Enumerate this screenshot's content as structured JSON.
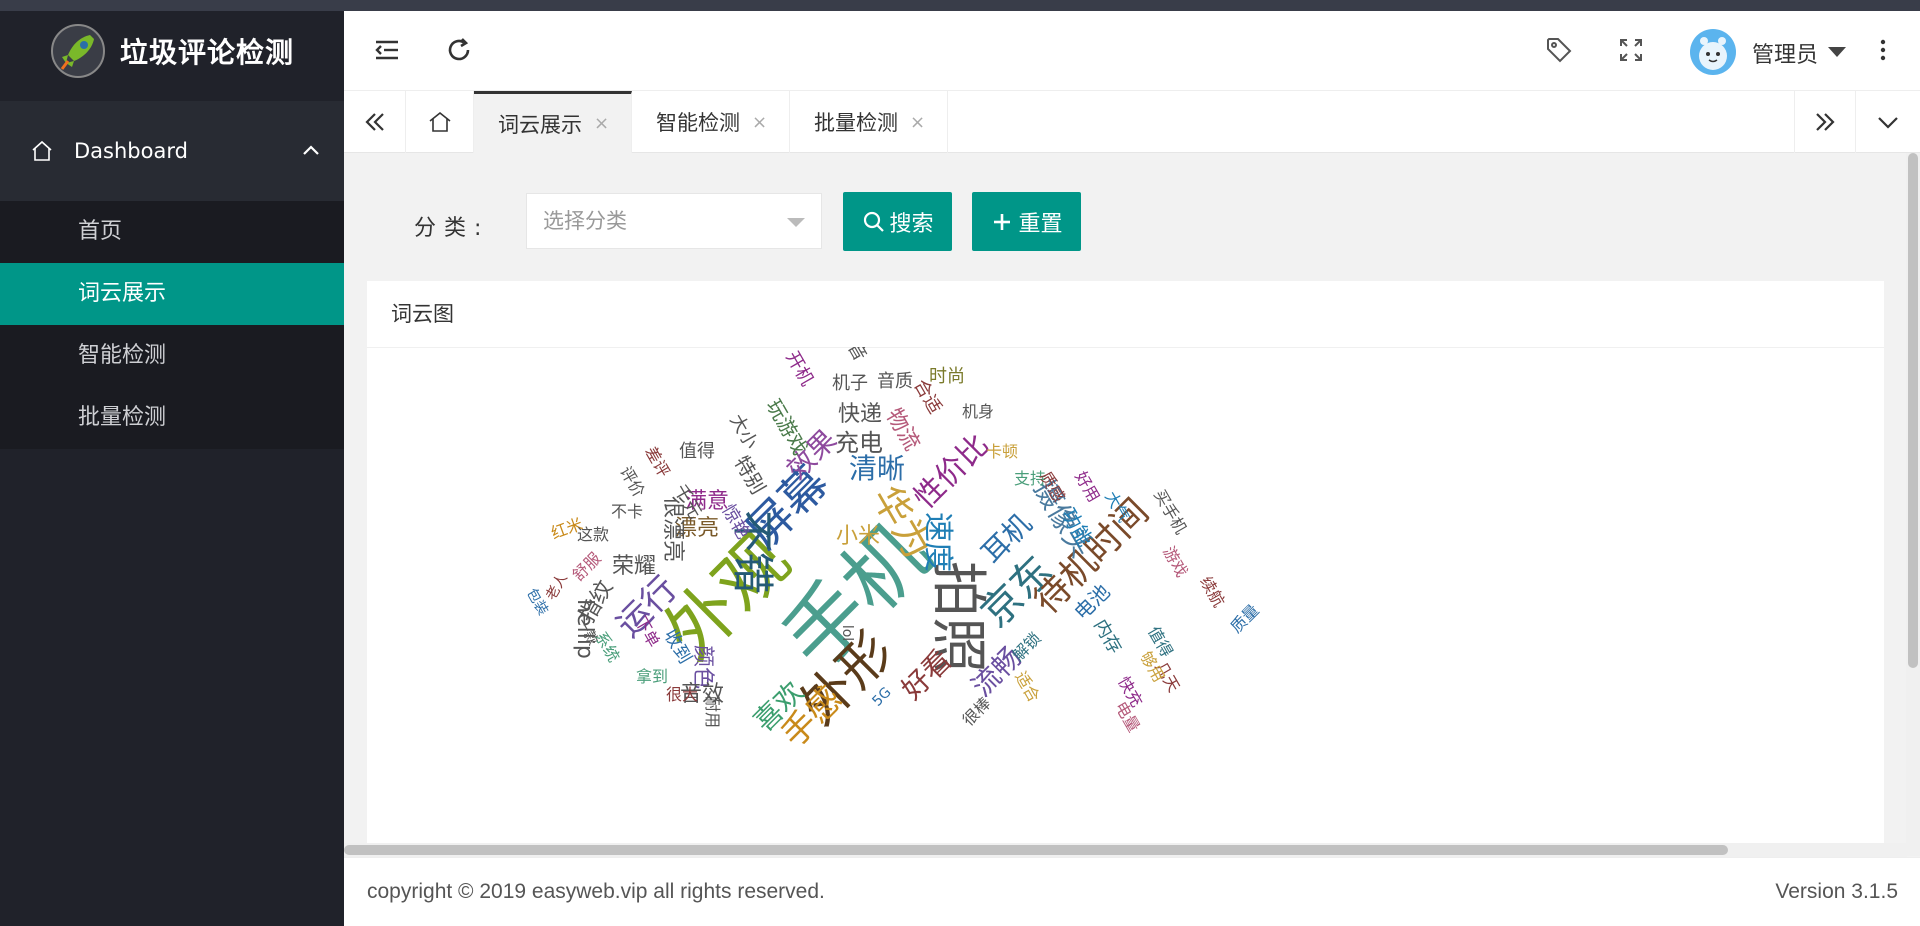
{
  "app": {
    "title": "垃圾评论检测"
  },
  "sidebar": {
    "group_label": "Dashboard",
    "items": [
      {
        "label": "首页"
      },
      {
        "label": "词云展示",
        "active": true
      },
      {
        "label": "智能检测"
      },
      {
        "label": "批量检测"
      }
    ]
  },
  "header": {
    "user_name": "管理员"
  },
  "tabs": [
    {
      "label": "词云展示",
      "close": "×",
      "active": true
    },
    {
      "label": "智能检测",
      "close": "×"
    },
    {
      "label": "批量检测",
      "close": "×"
    }
  ],
  "search": {
    "label": "分类:",
    "placeholder": "选择分类",
    "search_button": "搜索",
    "reset_button": "重置"
  },
  "card": {
    "title": "词云图"
  },
  "wordcloud": {
    "words": [
      {
        "t": "手机",
        "c": "#4b9e8e"
      },
      {
        "t": "外观",
        "c": "#7ea31d"
      },
      {
        "t": "外形",
        "c": "#5a3b1a"
      },
      {
        "t": "拍照",
        "c": "#555555"
      },
      {
        "t": "屏幕",
        "c": "#2d5aa0"
      },
      {
        "t": "不错",
        "c": "#245a76"
      },
      {
        "t": "华为",
        "c": "#c9a03a"
      },
      {
        "t": "京东",
        "c": "#2e7180"
      },
      {
        "t": "待机时间",
        "c": "#7a4a2a"
      },
      {
        "t": "速度",
        "c": "#1e7eb5"
      },
      {
        "t": "运行",
        "c": "#6a4fa0"
      },
      {
        "t": "效果",
        "c": "#8e4a9e"
      },
      {
        "t": "清晰",
        "c": "#2c6ea8"
      },
      {
        "t": "性价比",
        "c": "#8e2a8a"
      },
      {
        "t": "耳机",
        "c": "#2c6ea8"
      },
      {
        "t": "摄像头",
        "c": "#4a7a9e"
      },
      {
        "t": "流畅",
        "c": "#6a4fa0"
      },
      {
        "t": "好看",
        "c": "#8a3a3a"
      },
      {
        "t": "喜欢",
        "c": "#3b9e6e"
      },
      {
        "t": "手感",
        "c": "#c98a1a"
      },
      {
        "t": "充电",
        "c": "#555555"
      },
      {
        "t": "快递",
        "c": "#555555"
      },
      {
        "t": "物流",
        "c": "#b55a7a"
      },
      {
        "t": "小米",
        "c": "#c9a03a"
      },
      {
        "t": "漂亮",
        "c": "#7a5a2a"
      },
      {
        "t": "满意",
        "c": "#8e2a8a"
      },
      {
        "t": "很漂亮",
        "c": "#555555"
      },
      {
        "t": "荣耀",
        "c": "#555555"
      },
      {
        "t": "指纹",
        "c": "#555555"
      },
      {
        "t": "hellip",
        "c": "#555555"
      },
      {
        "t": "颜色",
        "c": "#6a4fa0"
      },
      {
        "t": "音效",
        "c": "#555555"
      },
      {
        "t": "电池",
        "c": "#2c6ea8"
      },
      {
        "t": "内存",
        "c": "#2e7180"
      },
      {
        "t": "功能",
        "c": "#1e7eb5"
      },
      {
        "t": "特别",
        "c": "#555555"
      },
      {
        "t": "玩游戏",
        "c": "#4a7a4a"
      },
      {
        "t": "大小",
        "c": "#555555"
      },
      {
        "t": "机子",
        "c": "#555555"
      },
      {
        "t": "音质",
        "c": "#555555"
      },
      {
        "t": "时尚",
        "c": "#7a7a2a"
      },
      {
        "t": "开机",
        "c": "#8e2a8a"
      },
      {
        "t": "声音",
        "c": "#555555"
      },
      {
        "t": "合适",
        "c": "#8a3a3a"
      },
      {
        "t": "机身",
        "c": "#555555"
      },
      {
        "t": "卡顿",
        "c": "#c9a03a"
      },
      {
        "t": "支持",
        "c": "#4a9e7a"
      },
      {
        "t": "质感",
        "c": "#8a3a3a"
      },
      {
        "t": "好用",
        "c": "#8e2a8a"
      },
      {
        "t": "大气",
        "c": "#1e7eb5"
      },
      {
        "t": "买手机",
        "c": "#555555"
      },
      {
        "t": "游戏",
        "c": "#b55a7a"
      },
      {
        "t": "续航",
        "c": "#8a3a3a"
      },
      {
        "t": "质量",
        "c": "#2c6ea8"
      },
      {
        "t": "值得",
        "c": "#2e7180"
      },
      {
        "t": "几天",
        "c": "#8a3a3a"
      },
      {
        "t": "够用",
        "c": "#c9a03a"
      },
      {
        "t": "快充",
        "c": "#8e2a8a"
      },
      {
        "t": "电量",
        "c": "#b55a7a"
      },
      {
        "t": "惊艳",
        "c": "#6a4fa0"
      },
      {
        "t": "千元",
        "c": "#555555"
      },
      {
        "t": "值得",
        "c": "#555555"
      },
      {
        "t": "差评",
        "c": "#8a3a3a"
      },
      {
        "t": "评价",
        "c": "#555555"
      },
      {
        "t": "不卡",
        "c": "#555555"
      },
      {
        "t": "红米",
        "c": "#c98a1a"
      },
      {
        "t": "这款",
        "c": "#555555"
      },
      {
        "t": "舒服",
        "c": "#b55a7a"
      },
      {
        "t": "老人",
        "c": "#8a3a3a"
      },
      {
        "t": "包装",
        "c": "#2c6ea8"
      },
      {
        "t": "一款",
        "c": "#555555"
      },
      {
        "t": "系统",
        "c": "#4a9e7a"
      },
      {
        "t": "下单",
        "c": "#8e2a8a"
      },
      {
        "t": "收到",
        "c": "#2c6ea8"
      },
      {
        "t": "拿到",
        "c": "#4a9e7a"
      },
      {
        "t": "很大",
        "c": "#8a3a3a"
      },
      {
        "t": "耐用",
        "c": "#555555"
      },
      {
        "t": "解锁",
        "c": "#2e7180"
      },
      {
        "t": "适合",
        "c": "#c9a03a"
      },
      {
        "t": "很棒",
        "c": "#555555"
      },
      {
        "t": "5G",
        "c": "#2c6ea8"
      },
      {
        "t": "lol",
        "c": "#555555"
      }
    ]
  },
  "footer": {
    "copyright": "copyright © 2019 easyweb.vip all rights reserved.",
    "version": "Version 3.1.5"
  }
}
